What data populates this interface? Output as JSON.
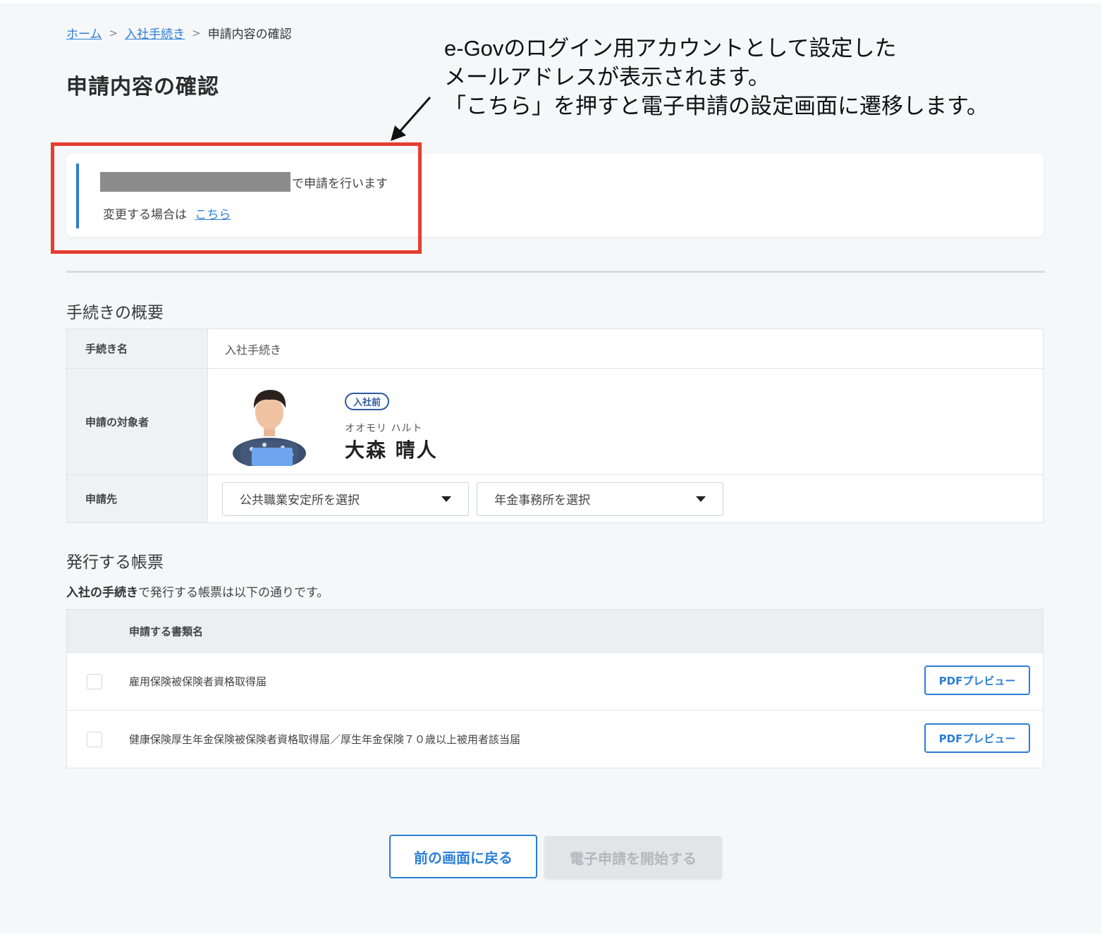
{
  "breadcrumb": {
    "home": "ホーム",
    "onboarding": "入社手続き",
    "current": "申請内容の確認",
    "separator": ">"
  },
  "page_title": "申請内容の確認",
  "annotation": {
    "line1": "e-Govのログイン用アカウントとして設定した",
    "line2": "メールアドレスが表示されます。",
    "line3": "「こちら」を押すと電子申請の設定画面に遷移します。"
  },
  "info": {
    "applying_text": "で申請を行います",
    "change_prefix": "変更する場合は",
    "change_link": "こちら"
  },
  "overview": {
    "heading": "手続きの概要",
    "procedure_label": "手続き名",
    "procedure_value": "入社手続き",
    "target_label": "申請の対象者",
    "badge": "入社前",
    "kana": "オオモリ ハルト",
    "name": "大森 晴人",
    "destination_label": "申請先",
    "select_employment_office": "公共職業安定所を選択",
    "select_pension_office": "年金事務所を選択"
  },
  "documents": {
    "heading": "発行する帳票",
    "note_bold": "入社の手続き",
    "note_rest": "で発行する帳票は以下の通りです。",
    "column_header": "申請する書類名",
    "rows": [
      {
        "name": "雇用保険被保険者資格取得届",
        "button": "PDFプレビュー"
      },
      {
        "name": "健康保険厚生年金保険被保険者資格取得届／厚生年金保険７０歳以上被用者該当届",
        "button": "PDFプレビュー"
      }
    ]
  },
  "actions": {
    "back": "前の画面に戻る",
    "start": "電子申請を開始する"
  },
  "colors": {
    "accent": "#2a7ed6",
    "highlight": "#e53e30",
    "redacted": "#8c8c8c"
  }
}
